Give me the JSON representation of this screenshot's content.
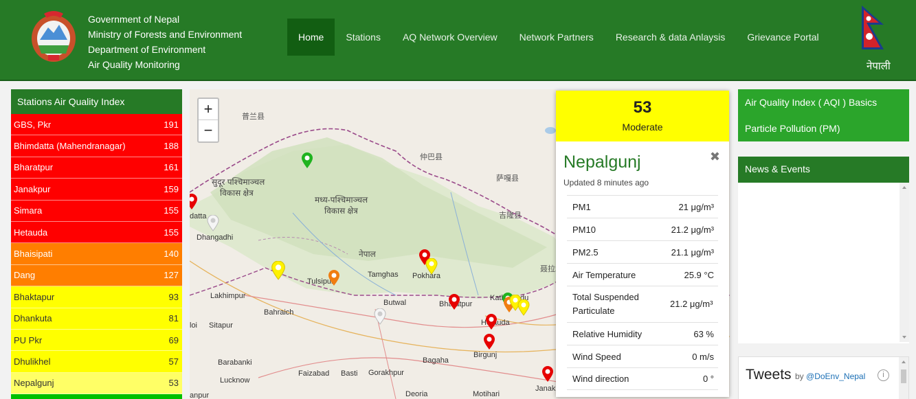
{
  "header": {
    "gov_lines": [
      "Government of Nepal",
      "Ministry of Forests and Environment",
      "Department of Environment",
      "Air Quality Monitoring"
    ],
    "nav": [
      "Home",
      "Stations",
      "AQ Network Overview",
      "Network Partners",
      "Research & data Anlaysis",
      "Grievance Portal"
    ],
    "active_nav": "Home",
    "language_toggle": "नेपाली"
  },
  "stations_panel": {
    "title": "Stations Air Quality Index",
    "stations": [
      {
        "name": "GBS, Pkr",
        "aqi": "191",
        "level": "red"
      },
      {
        "name": "Bhimdatta (Mahendranagar)",
        "aqi": "188",
        "level": "red"
      },
      {
        "name": "Bharatpur",
        "aqi": "161",
        "level": "red"
      },
      {
        "name": "Janakpur",
        "aqi": "159",
        "level": "red"
      },
      {
        "name": "Simara",
        "aqi": "155",
        "level": "red"
      },
      {
        "name": "Hetauda",
        "aqi": "155",
        "level": "red"
      },
      {
        "name": "Bhaisipati",
        "aqi": "140",
        "level": "orange"
      },
      {
        "name": "Dang",
        "aqi": "127",
        "level": "orange"
      },
      {
        "name": "Bhaktapur",
        "aqi": "93",
        "level": "yellow"
      },
      {
        "name": "Dhankuta",
        "aqi": "81",
        "level": "yellow"
      },
      {
        "name": "PU Pkr",
        "aqi": "69",
        "level": "yellow"
      },
      {
        "name": "Dhulikhel",
        "aqi": "57",
        "level": "yellow"
      },
      {
        "name": "Nepalgunj",
        "aqi": "53",
        "level": "lightyellow"
      }
    ]
  },
  "map": {
    "zoom_in": "+",
    "zoom_out": "−",
    "labels": [
      "普兰县",
      "仲巴县",
      "萨嘎县",
      "吉隆县",
      "聂拉木",
      "सुदूर पश्चिमाञ्चल",
      "विकास क्षेत्र",
      "मध्य-पश्चिमाञ्चल",
      "विकास क्षेत्र",
      "नेपाल",
      "Dhangadhi",
      "Tulsipur",
      "Lakhimpur",
      "Tamghas",
      "Pokhara",
      "Butwal",
      "Bahraich",
      "Sitapur",
      "Bharatpur",
      "Kathmandu",
      "Hetauda",
      "Birgunj",
      "Barabanki",
      "Bagaha",
      "Lucknow",
      "Faizabad",
      "Basti",
      "Gorakhpur",
      "Deoria",
      "Motihari",
      "Janakpur",
      "datta",
      "loi",
      "anpur"
    ]
  },
  "popup": {
    "aqi": "53",
    "category": "Moderate",
    "close": "✖",
    "city": "Nepalgunj",
    "updated": "Updated 8 minutes ago",
    "rows": [
      {
        "label": "PM1",
        "value": "21 μg/m³"
      },
      {
        "label": "PM10",
        "value": "21.2 μg/m³"
      },
      {
        "label": "PM2.5",
        "value": "21.1 μg/m³"
      },
      {
        "label": "Air Temperature",
        "value": "25.9 °C"
      },
      {
        "label": "Total Suspended Particulate",
        "value": "21.2 μg/m³"
      },
      {
        "label": "Relative Humidity",
        "value": "63 %"
      },
      {
        "label": "Wind Speed",
        "value": "0 m/s"
      },
      {
        "label": "Wind direction",
        "value": "0 °"
      }
    ],
    "colors": {
      "moderate": "#ffff00",
      "city": "#267a26"
    }
  },
  "sidebar_right": {
    "links": [
      "Air Quality Index ( AQI ) Basics",
      "Particle Pollution (PM)"
    ],
    "news_title": "News & Events",
    "tweets_title": "Tweets",
    "tweets_by": "by",
    "tweets_handle": "@DoEnv_Nepal",
    "info_icon": "ⓘ"
  },
  "colors": {
    "header": "#267a26",
    "red": "#ff0000",
    "orange": "#ff7e00",
    "yellow": "#ffff00"
  }
}
